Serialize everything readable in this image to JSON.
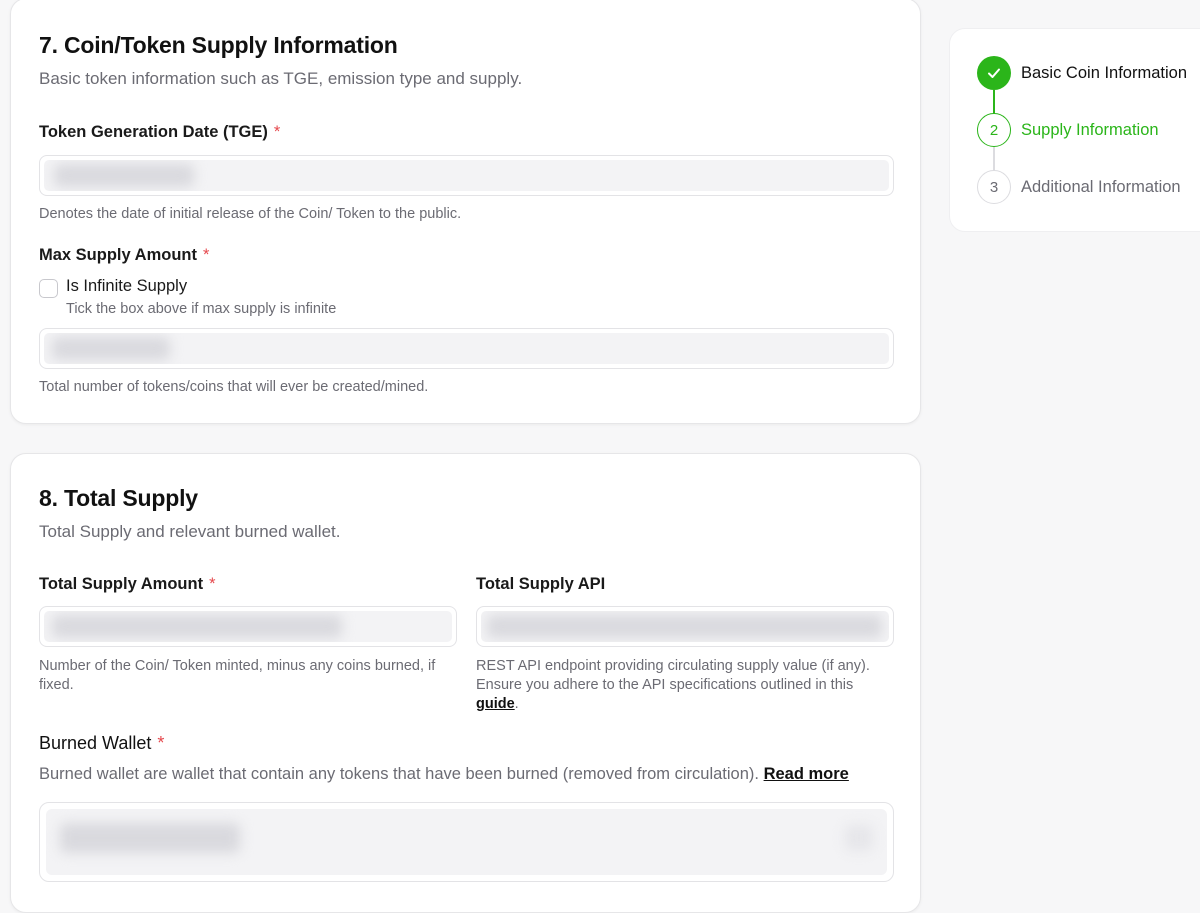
{
  "section7": {
    "title": "7. Coin/Token Supply Information",
    "subtitle": "Basic token information such as TGE, emission type and supply.",
    "tge": {
      "label": "Token Generation Date (TGE)",
      "required": "*",
      "help": "Denotes the date of initial release of the Coin/ Token to the public."
    },
    "max_supply": {
      "label": "Max Supply Amount",
      "required": "*",
      "checkbox_label": "Is Infinite Supply",
      "checkbox_help": "Tick the box above if max supply is infinite",
      "help": "Total number of tokens/coins that will ever be created/mined."
    }
  },
  "section8": {
    "title": "8. Total Supply",
    "subtitle": "Total Supply and relevant burned wallet.",
    "total_supply_amount": {
      "label": "Total Supply Amount",
      "required": "*",
      "help": "Number of the Coin/ Token minted, minus any coins burned, if fixed."
    },
    "total_supply_api": {
      "label": "Total Supply API",
      "help_line1": "REST API endpoint providing circulating supply value (if any).",
      "help_line2": "Ensure you adhere to the API specifications outlined in this",
      "guide_link": "guide",
      "help_end": "."
    },
    "burned_wallet": {
      "label": "Burned Wallet",
      "required": "*",
      "description": "Burned wallet are wallet that contain any tokens that have been burned (removed from circulation).",
      "read_more": "Read more"
    }
  },
  "stepper": {
    "steps": [
      {
        "number": "",
        "label": "Basic Coin Information",
        "state": "done"
      },
      {
        "number": "2",
        "label": "Supply Information",
        "state": "active"
      },
      {
        "number": "3",
        "label": "Additional Information",
        "state": "pending"
      }
    ],
    "colors": {
      "done": "#2bb51a",
      "active": "#2bb51a",
      "pending": "#9a9aa2",
      "check_icon": "check-icon"
    }
  }
}
